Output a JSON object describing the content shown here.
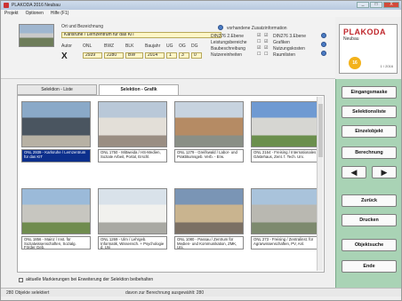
{
  "window": {
    "title": "PLAKODA 2016 Neubau",
    "controls": [
      "_",
      "□",
      "X"
    ]
  },
  "menu": [
    "Projekt",
    "Optionen",
    "Hilfe (F1)"
  ],
  "header": {
    "location_label": "Ort und Bezeichnung",
    "location_value": "Karlsruhe / Lernzentrum für das KIT",
    "col_labels": [
      "Autor",
      "ONL",
      "BWZ",
      "BLK",
      "Baujahr",
      "UG",
      "OG",
      "DG"
    ],
    "values": {
      "onl": "2939",
      "bwz": "2280",
      "blk": "BW",
      "baujahr": "2014",
      "ug": "1",
      "og": "3",
      "dg": "0"
    },
    "delete_mark": "X",
    "extra_title": "vorhandene Zusatzinformation",
    "extra_items": [
      {
        "label": "DIN276 2.Ebene",
        "checked": "☑"
      },
      {
        "label": "Leistungsbereiche",
        "checked": "☐"
      },
      {
        "label": "Baubeschreibung",
        "checked": "☑"
      },
      {
        "label": "Nutzereinheiten",
        "checked": "☐"
      }
    ],
    "extra_items2": [
      {
        "label": "DIN276 3.Ebene",
        "checked": "☑"
      },
      {
        "label": "Grafiken",
        "checked": "☑"
      },
      {
        "label": "Nutzungskosten",
        "checked": "☑"
      },
      {
        "label": "Raumlisten",
        "checked": "☐"
      }
    ]
  },
  "logo": {
    "brand": "PLAKODA",
    "sub": "Neubau",
    "badge": "16",
    "date": "1 / 2016"
  },
  "tabs": [
    {
      "label": "Selektion - Liste"
    },
    {
      "label": "Selektion - Grafik"
    }
  ],
  "projects": [
    {
      "caption": "ONL 2939 - Karlsruhe / Lernzentrum für das KIT",
      "selected": true,
      "colors": [
        "#8aa9c8",
        "#4a5560",
        "#b7b1a4"
      ]
    },
    {
      "caption": "ONL 1750 - Mittweida / HS-Medien, Soziale Arbeit, Portal, Erschl.",
      "selected": false,
      "colors": [
        "#b9c8d8",
        "#e3dfd8",
        "#9a8e83"
      ]
    },
    {
      "caption": "ONL 1279 - Greifswald / Labor- und Praktikumsgeb. Verb. - Erw.",
      "selected": false,
      "colors": [
        "#c7d3df",
        "#b58b64",
        "#8a8f86"
      ]
    },
    {
      "caption": "ONL 2164 - Freising / Internationales Gästehaus, Zent. f. Tech. Uni.",
      "selected": false,
      "colors": [
        "#6f9ad2",
        "#d6d6d2",
        "#6b8f4d"
      ]
    },
    {
      "caption": "ONL 1856 - Mainz / Inst. für Sozialwissenschaften, Sozialg. Förder Geb.",
      "selected": false,
      "colors": [
        "#9bbad9",
        "#c7c6c0",
        "#6f8c4e"
      ]
    },
    {
      "caption": "ONL 1269 - Ulm / Lehrgeb. Informatik, Wissensch. + Psychologie d. Uni",
      "selected": false,
      "colors": [
        "#d9e2ea",
        "#f1f1ee",
        "#a9a9a3"
      ]
    },
    {
      "caption": "ONL 1080 - Passau / Zentrum für Medien- und Kommunikation, ZMK, Uni.",
      "selected": false,
      "colors": [
        "#7a95b5",
        "#c9b48f",
        "#7b7064"
      ]
    },
    {
      "caption": "ONL 273 - Freising / Zentralinst. für Agrarwissenschaften, PV, Anl.",
      "selected": false,
      "colors": [
        "#a9c3db",
        "#b9b8b1",
        "#7d8a6e"
      ]
    }
  ],
  "keep_selection_label": "aktuelle Markierungen bei Erweiterung der Selektion beibehalten",
  "status": {
    "left": "280 Objekte selektiert",
    "right": "davon zur Berechnung ausgewählt: 280"
  },
  "side_buttons": {
    "eingabemaske": "Eingangsmaske",
    "selektionsliste": "Selektionsliste",
    "einzelobjekt": "Einzelobjekt",
    "berechnung": "Berechnung",
    "prev": "◀",
    "next": "▶",
    "zurueck": "Zurück",
    "drucken": "Drucken",
    "objektsuche": "Objektsuche",
    "ende": "Ende"
  }
}
